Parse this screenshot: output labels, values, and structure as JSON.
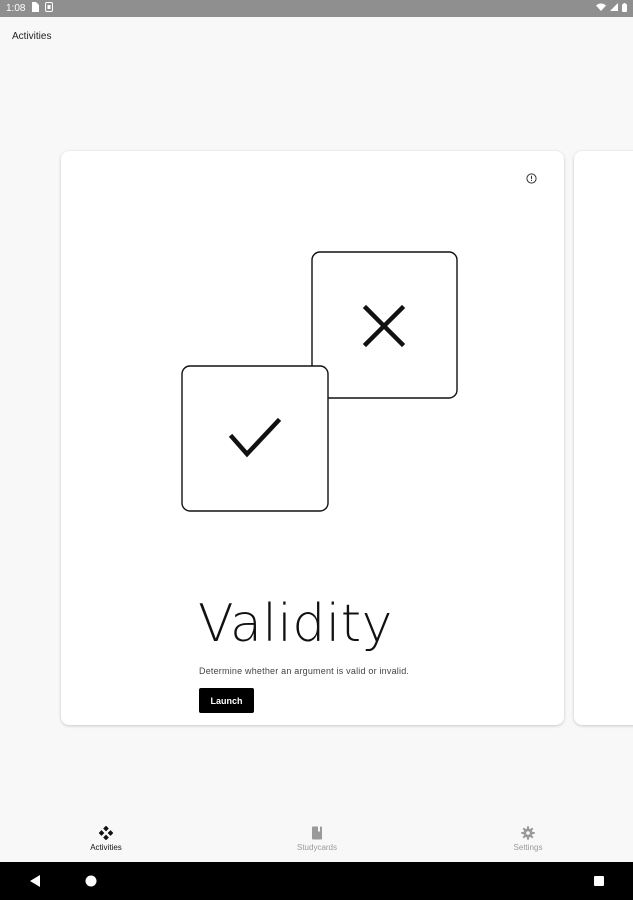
{
  "status_bar": {
    "time": "1:08",
    "icons": [
      "sim-card-icon",
      "notification-icon",
      "wifi-icon",
      "signal-icon",
      "battery-icon"
    ]
  },
  "header": {
    "title": "Activities"
  },
  "card": {
    "title": "Validity",
    "description": "Determine whether an argument is valid or invalid.",
    "launch_label": "Launch",
    "illustration": [
      "check-box-icon",
      "cross-box-icon"
    ],
    "info_icon": "info-icon"
  },
  "bottom_nav": {
    "items": [
      {
        "label": "Activities",
        "icon": "activities-icon",
        "active": true
      },
      {
        "label": "Studycards",
        "icon": "studycards-icon",
        "active": false
      },
      {
        "label": "Settings",
        "icon": "gear-icon",
        "active": false
      }
    ]
  },
  "system_nav": {
    "buttons": [
      "back-icon",
      "home-icon",
      "recents-icon"
    ]
  },
  "colors": {
    "background": "#f8f8f8",
    "status_bar": "#8f8f8f",
    "card": "#ffffff",
    "accent": "#000000",
    "inactive_nav": "#9a9a9a"
  }
}
